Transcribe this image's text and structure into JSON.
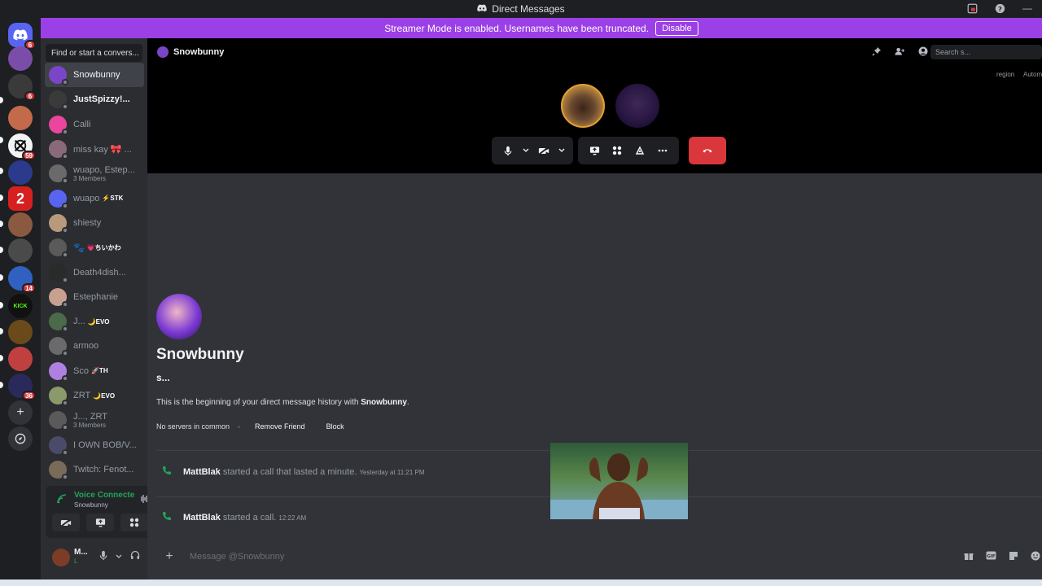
{
  "window": {
    "title": "Direct Messages"
  },
  "banner": {
    "text": "Streamer Mode is enabled. Usernames have been truncated.",
    "button": "Disable"
  },
  "rail": {
    "servers": [
      {
        "icon": "discord-home-icon",
        "color": "#5865f2",
        "badge": "6"
      },
      {
        "icon": "server-avatar",
        "color": "#7a4ea8",
        "badge": ""
      },
      {
        "icon": "server-avatar",
        "color": "#3a3a3a",
        "badge": "6"
      },
      {
        "icon": "server-avatar",
        "color": "#c26a4a",
        "badge": ""
      },
      {
        "icon": "server-avatar",
        "color": "#f2f3f5",
        "badge": "59"
      },
      {
        "icon": "server-avatar",
        "color": "#2b3a8a",
        "badge": ""
      },
      {
        "icon": "server-avatar",
        "color": "#d62020",
        "label": "2",
        "badge": ""
      },
      {
        "icon": "server-avatar",
        "color": "#8a5a40",
        "badge": ""
      },
      {
        "icon": "server-avatar",
        "color": "#4a4a4a",
        "badge": ""
      },
      {
        "icon": "server-avatar",
        "color": "#3060c0",
        "badge": "14"
      },
      {
        "icon": "server-avatar",
        "color": "#111111",
        "label": "KICK",
        "badge": ""
      },
      {
        "icon": "server-avatar",
        "color": "#6a4a1a",
        "badge": ""
      },
      {
        "icon": "server-avatar",
        "color": "#c04040",
        "badge": ""
      },
      {
        "icon": "server-avatar",
        "color": "#2a2a5a",
        "badge": "36"
      }
    ]
  },
  "dm": {
    "find_placeholder": "Find or start a convers...",
    "items": [
      {
        "name": "Snowbunny",
        "sub": "",
        "tag": "",
        "color": "#7b45c8",
        "active": true,
        "bold": false
      },
      {
        "name": "JustSpizzy!...",
        "sub": "",
        "tag": "",
        "color": "#3a3a3a",
        "active": false,
        "bold": true
      },
      {
        "name": "Calli",
        "sub": "",
        "tag": "",
        "color": "#eb459e",
        "active": false,
        "bold": false
      },
      {
        "name": "miss kay 🎀 ...",
        "sub": "",
        "tag": "",
        "color": "#8a6a7a",
        "active": false,
        "bold": false
      },
      {
        "name": "wuapo, Estep...",
        "sub": "3 Members",
        "tag": "",
        "color": "#6a6a6a",
        "active": false,
        "bold": false
      },
      {
        "name": "wuapo",
        "sub": "",
        "tag": "⚡STK",
        "color": "#5865f2",
        "active": false,
        "bold": false
      },
      {
        "name": "shiesty",
        "sub": "",
        "tag": "",
        "color": "#b89a7a",
        "active": false,
        "bold": false
      },
      {
        "name": "🐾",
        "sub": "",
        "tag": "💗ちいかわ",
        "color": "#5a5a5a",
        "active": false,
        "bold": false
      },
      {
        "name": "Death4dish...",
        "sub": "",
        "tag": "",
        "color": "#2a2a2a",
        "active": false,
        "bold": false
      },
      {
        "name": "Estephanie",
        "sub": "",
        "tag": "",
        "color": "#c8a090",
        "active": false,
        "bold": false
      },
      {
        "name": "J...",
        "sub": "",
        "tag": "🌙EVO",
        "color": "#4a6a4a",
        "active": false,
        "bold": false
      },
      {
        "name": "armoo",
        "sub": "",
        "tag": "",
        "color": "#6a6a6a",
        "active": false,
        "bold": false
      },
      {
        "name": "Sco",
        "sub": "",
        "tag": "🚀TH",
        "color": "#b080e0",
        "active": false,
        "bold": false
      },
      {
        "name": "ZRT",
        "sub": "",
        "tag": "🌙EVO",
        "color": "#8a9a6a",
        "active": false,
        "bold": false
      },
      {
        "name": "J..., ZRT",
        "sub": "3 Members",
        "tag": "",
        "color": "#5a5a5a",
        "active": false,
        "bold": false
      },
      {
        "name": "I OWN BOB/V...",
        "sub": "",
        "tag": "",
        "color": "#4a4a6a",
        "active": false,
        "bold": false
      },
      {
        "name": "Twitch: Fenot...",
        "sub": "",
        "tag": "",
        "color": "#7a6a5a",
        "active": false,
        "bold": false
      }
    ]
  },
  "voice": {
    "status": "Voice Connecte",
    "channel": "Snowbunny"
  },
  "user": {
    "name": "M...",
    "status": "L"
  },
  "header": {
    "title": "Snowbunny",
    "search_placeholder": "Search s...",
    "region": "region",
    "auto": "Autom"
  },
  "intro": {
    "name": "Snowbunny",
    "username": "s...",
    "begin_prefix": "This is the beginning of your direct message history with ",
    "begin_name": "Snowbunny",
    "begin_suffix": ".",
    "no_servers": "No servers in common",
    "remove_friend": "Remove Friend",
    "block": "Block"
  },
  "messages": [
    {
      "author": "MattBlak",
      "action": "started a call that lasted a minute.",
      "time": "Yesterday at 11:21 PM"
    },
    {
      "author": "MattBlak",
      "action": "started a call.",
      "time": "12:22 AM"
    }
  ],
  "composer": {
    "placeholder": "Message @Snowbunny"
  }
}
